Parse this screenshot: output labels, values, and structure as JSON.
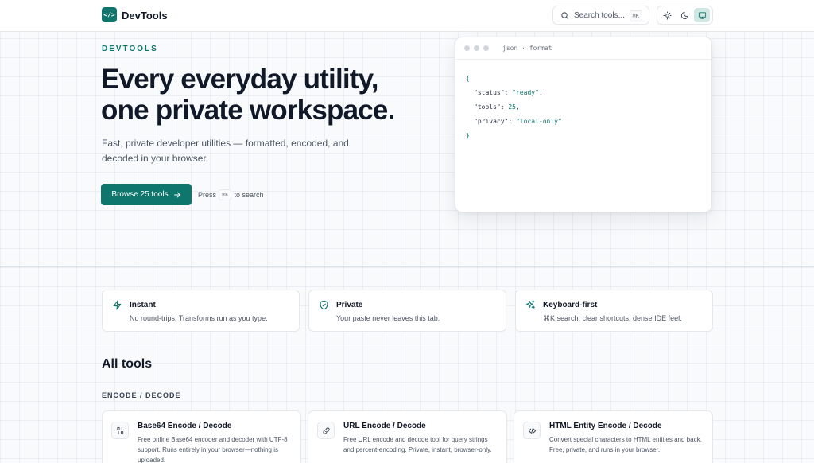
{
  "header": {
    "logo_glyph": "</>",
    "app_name": "DevTools",
    "search_placeholder": "Search tools...",
    "search_shortcut": "⌘K",
    "theme_options": [
      "light",
      "dark",
      "system"
    ],
    "active_theme": "system"
  },
  "hero": {
    "eyebrow": "DEVTOOLS",
    "title_line1": "Every everyday utility,",
    "title_line2": "one private workspace.",
    "subtitle": "Fast, private developer utilities — formatted, encoded, and decoded in your browser.",
    "cta_label": "Browse 25 tools",
    "press_text": "Press",
    "press_key": "⌘K",
    "press_suffix": "to search"
  },
  "code_preview": {
    "tab_label": "json · format",
    "open_brace": "{",
    "close_brace": "}",
    "lines": [
      {
        "key": "\"status\"",
        "value": "\"ready\"",
        "comma": ","
      },
      {
        "key": "\"tools\"",
        "value": "25",
        "comma": ","
      },
      {
        "key": "\"privacy\"",
        "value": "\"local-only\"",
        "comma": ""
      }
    ]
  },
  "features": [
    {
      "icon": "lightning-icon",
      "title": "Instant",
      "desc": "No round-trips. Transforms run as you type."
    },
    {
      "icon": "shield-check-icon",
      "title": "Private",
      "desc": "Your paste never leaves this tab."
    },
    {
      "icon": "sparkles-icon",
      "title": "Keyboard-first",
      "desc": "⌘K search, clear shortcuts, dense IDE feel."
    }
  ],
  "all_tools_heading": "All tools",
  "section_label": "ENCODE / DECODE",
  "tools": [
    {
      "icon": "binary-icon",
      "title": "Base64 Encode / Decode",
      "desc": "Free online Base64 encoder and decoder with UTF-8 support. Runs entirely in your browser—nothing is uploaded."
    },
    {
      "icon": "link-icon",
      "title": "URL Encode / Decode",
      "desc": "Free URL encode and decode tool for query strings and percent-encoding. Private, instant, browser-only."
    },
    {
      "icon": "code-icon",
      "title": "HTML Entity Encode / Decode",
      "desc": "Convert special characters to HTML entities and back. Free, private, and runs in your browser."
    }
  ],
  "colors": {
    "accent": "#0f766e",
    "background": "#f8fafc"
  }
}
